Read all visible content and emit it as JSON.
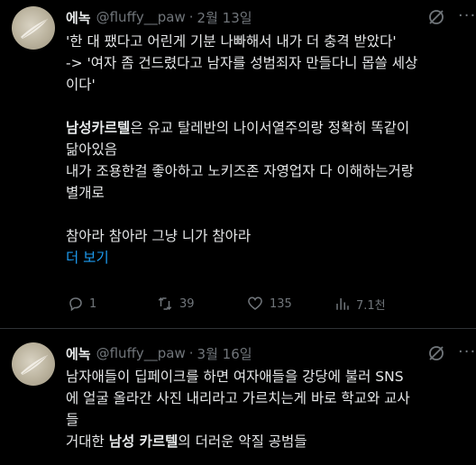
{
  "tweets": [
    {
      "name": "에녹",
      "handle": "@fluffy__paw",
      "separator": "·",
      "date": "2월 13일",
      "lines": [
        "'한 대 팼다고 어린게 기분 나빠해서 내가 더 충격 받았다'",
        "-> '여자 좀 건드렸다고 남자를 성범죄자 만들다니 몹쓸 세상",
        "이다'"
      ],
      "para2_bold": "남성카르텔",
      "para2_rest": "은 유교 탈레반의 나이서열주의랑 정확히 똑같이",
      "para2_lines": [
        "닮아있음",
        "내가 조용한걸 좋아하고 노키즈존 자영업자 다 이해하는거랑",
        "별개로"
      ],
      "para3": "참아라 참아라 그냥 니가 참아라",
      "show_more": "더 보기",
      "replies": "1",
      "retweets": "39",
      "likes": "135",
      "views": "7.1천"
    },
    {
      "name": "에녹",
      "handle": "@fluffy__paw",
      "separator": "·",
      "date": "3월 16일",
      "lines": [
        "남자애들이 딥페이크를 하면 여자애들을 강당에 불러 SNS",
        "에 얼굴 올라간 사진 내리라고 가르치는게 바로 학교와 교사",
        "들"
      ],
      "last_prefix": "거대한 ",
      "last_bold": "남성 카르텔",
      "last_suffix": "의 더러운 악질 공범들"
    }
  ],
  "icons": [
    "grok-icon",
    "more-icon",
    "reply-icon",
    "retweet-icon",
    "like-icon",
    "views-icon"
  ]
}
